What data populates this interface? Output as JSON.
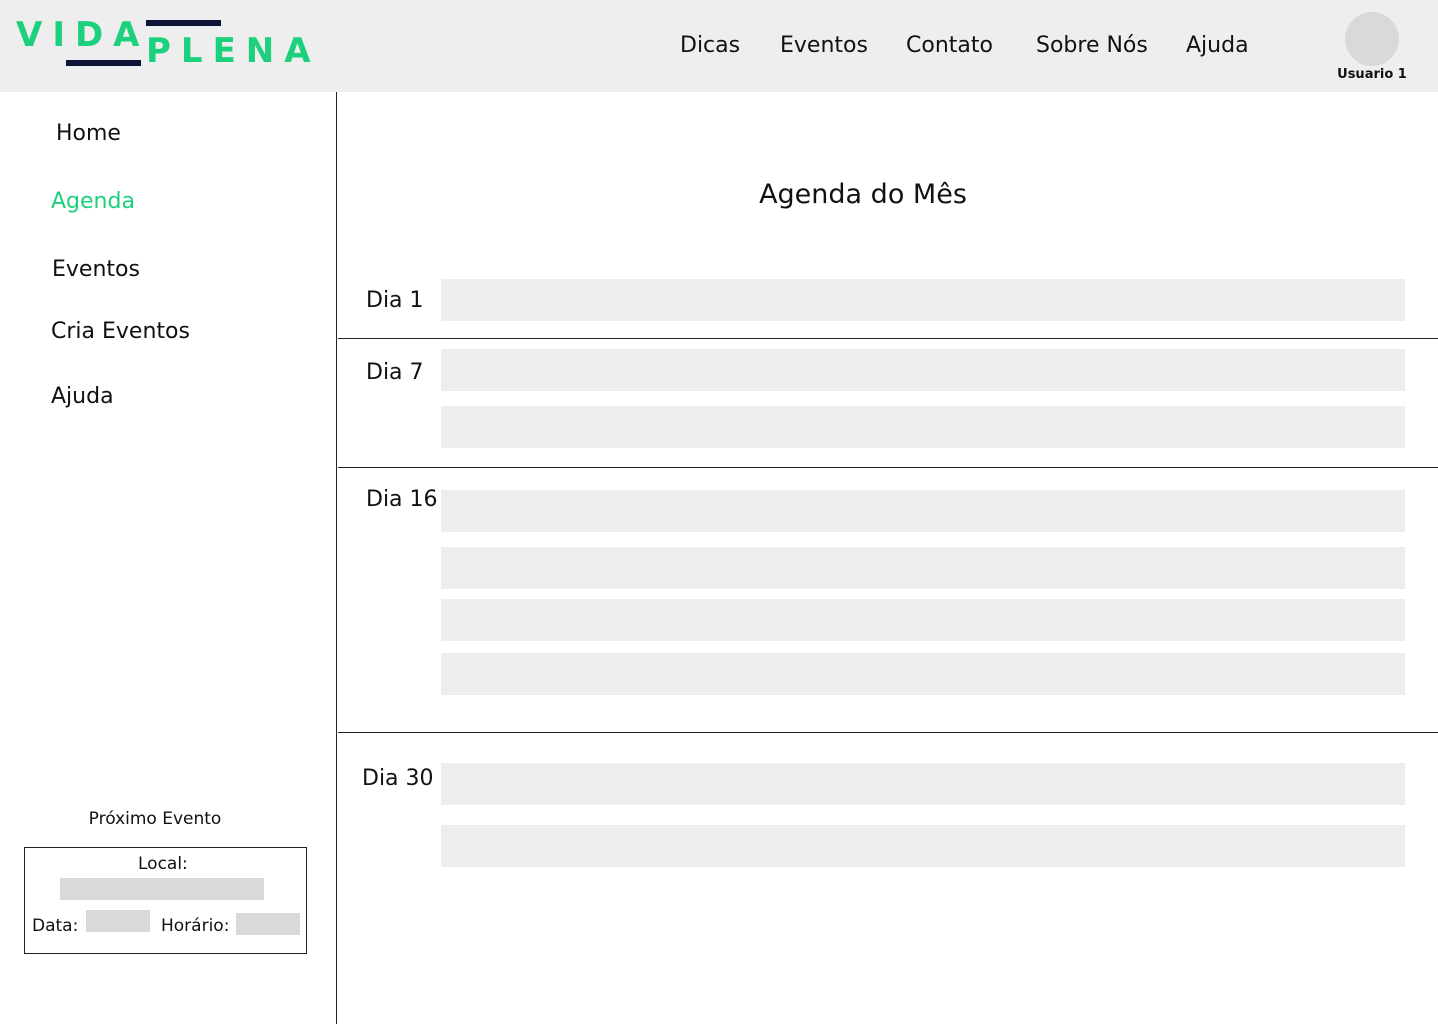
{
  "brand": {
    "word1": "VIDA",
    "word2": "PLENA",
    "accent_color": "#1dd07d",
    "line_color": "#0b1437"
  },
  "top_nav": [
    "Dicas",
    "Eventos",
    "Contato",
    "Sobre Nós",
    "Ajuda"
  ],
  "user": {
    "name": "Usuario 1",
    "avatar_icon": "user-avatar-icon"
  },
  "sidebar": {
    "items": [
      {
        "label": "Home",
        "active": false
      },
      {
        "label": "Agenda",
        "active": true
      },
      {
        "label": "Eventos",
        "active": false
      },
      {
        "label": "Cria Eventos",
        "active": false
      },
      {
        "label": "Ajuda",
        "active": false
      }
    ]
  },
  "next_event": {
    "title": "Próximo Evento",
    "local_label": "Local:",
    "data_label": "Data:",
    "horario_label": "Horário:"
  },
  "main": {
    "title": "Agenda do Mês",
    "days": [
      {
        "label": "Dia 1",
        "event_count": 1
      },
      {
        "label": "Dia 7",
        "event_count": 2
      },
      {
        "label": "Dia 16",
        "event_count": 4
      },
      {
        "label": "Dia 30",
        "event_count": 2
      }
    ]
  }
}
